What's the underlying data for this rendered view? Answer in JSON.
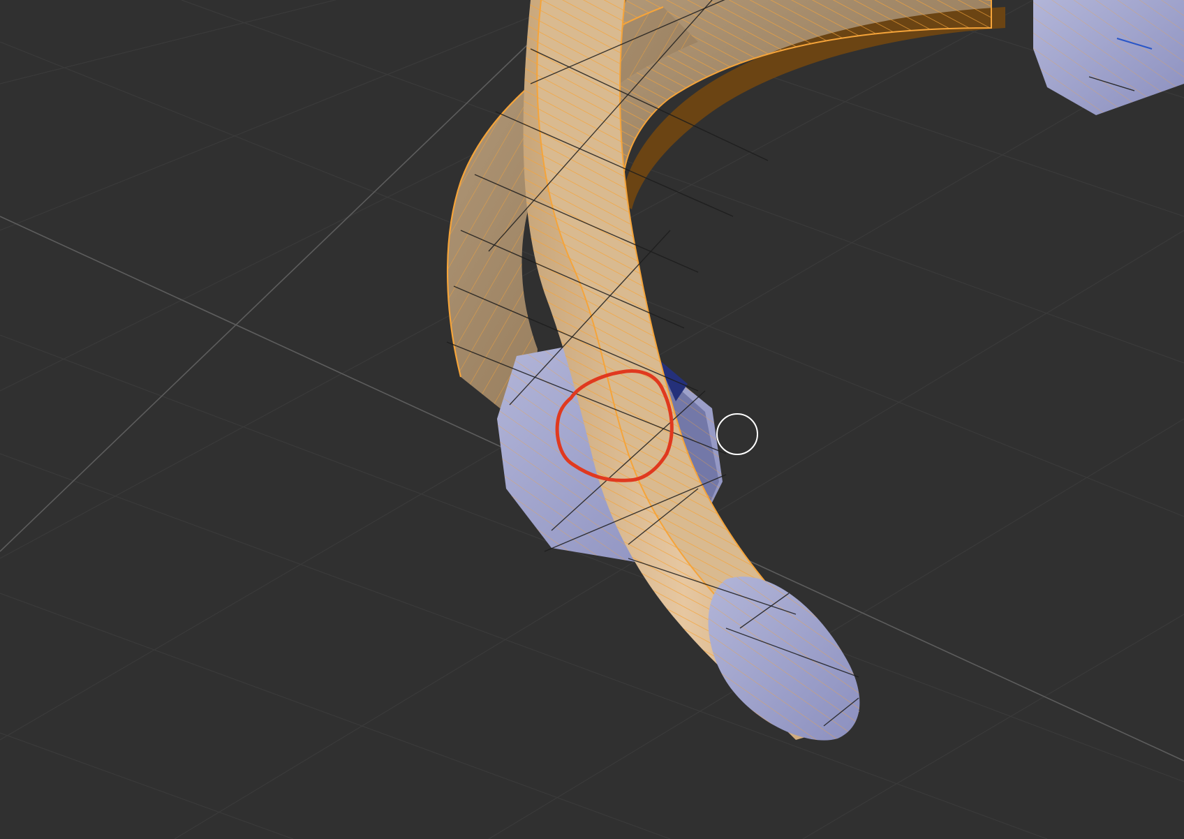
{
  "viewport": {
    "background": "#303030",
    "grid_color": "#3a3a3a",
    "axis_color": "#5d5d5d"
  },
  "mesh": {
    "selected_wire_color": "#f5a43a",
    "tube_face_color": "#cdb08a",
    "band_face_color": "#8a7458",
    "band_inner_color": "#6b4413",
    "unselected_face_color": "#a3a7cf",
    "unselected_dark_color": "#7378a8"
  },
  "annotation": {
    "shape": "hand-drawn-circle",
    "color": "#e0391f"
  },
  "cursor": {
    "shape": "circle-outline",
    "color": "#ffffff"
  }
}
